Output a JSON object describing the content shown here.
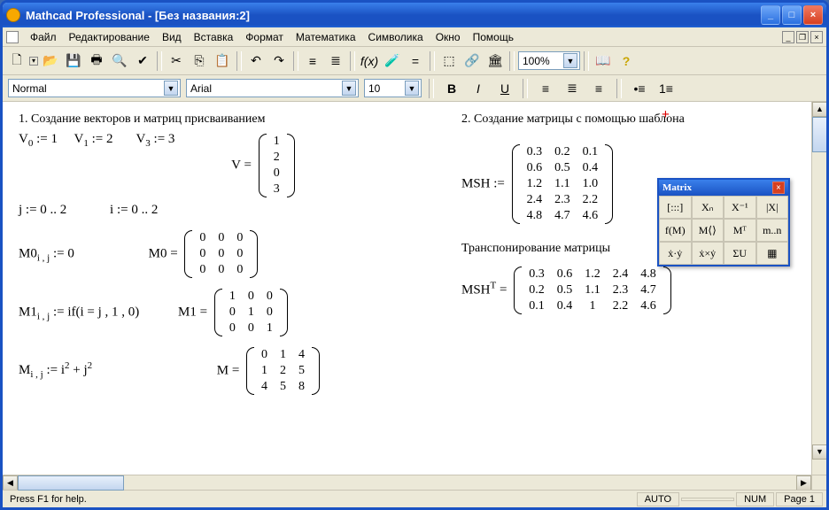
{
  "title": "Mathcad Professional - [Без названия:2]",
  "menus": [
    "Файл",
    "Редактирование",
    "Вид",
    "Вставка",
    "Формат",
    "Математика",
    "Символика",
    "Окно",
    "Помощь"
  ],
  "zoom": "100%",
  "style": "Normal",
  "font": "Arial",
  "fontsize": "10",
  "status_left": "Press F1 for help.",
  "status_auto": "AUTO",
  "status_num": "NUM",
  "status_page": "Page 1",
  "palette_title": "Matrix",
  "palette_cells": [
    "[:::]",
    "Xₙ",
    "X⁻¹",
    "|X|",
    "f(M)",
    "M⟨⟩",
    "Mᵀ",
    "m..n",
    "ẋ·ẏ",
    "ẋ×ẏ",
    "ΣU",
    "▦"
  ],
  "doc": {
    "h1": "1. Создание векторов и матриц присваиванием",
    "h2": "2. Создание матрицы с помощью шаблона",
    "h2b": "Транспонирование матрицы",
    "v0": "V",
    "v0sub": "0",
    "v0eq": " := 1",
    "v1": "V",
    "v1sub": "1",
    "v1eq": " := 2",
    "v3": "V",
    "v3sub": "3",
    "v3eq": " := 3",
    "j": "j := 0 .. 2",
    "i": "i := 0 .. 2",
    "m0": "M0",
    "m0sub": "i , j",
    "m0eq": " := 0",
    "m1": "M1",
    "m1sub": "i , j",
    "m1eq": " := if(i = j , 1 , 0)",
    "m": "M",
    "msub": "i , j",
    "meq": " := i",
    "msup1": "2",
    "mplus": " + j",
    "msup2": "2",
    "Vlabel": "V =",
    "M0label": "M0 =",
    "M1label": "M1 =",
    "Mlabel": "M =",
    "MSHlabel": "MSH :=",
    "MSHTlabel_pre": "MSH",
    "MSHTlabel_sup": "T",
    "MSHTlabel_post": " =",
    "V": [
      [
        "1"
      ],
      [
        "2"
      ],
      [
        "0"
      ],
      [
        "3"
      ]
    ],
    "M0": [
      [
        "0",
        "0",
        "0"
      ],
      [
        "0",
        "0",
        "0"
      ],
      [
        "0",
        "0",
        "0"
      ]
    ],
    "M1": [
      [
        "1",
        "0",
        "0"
      ],
      [
        "0",
        "1",
        "0"
      ],
      [
        "0",
        "0",
        "1"
      ]
    ],
    "M": [
      [
        "0",
        "1",
        "4"
      ],
      [
        "1",
        "2",
        "5"
      ],
      [
        "4",
        "5",
        "8"
      ]
    ],
    "MSH": [
      [
        "0.3",
        "0.2",
        "0.1"
      ],
      [
        "0.6",
        "0.5",
        "0.4"
      ],
      [
        "1.2",
        "1.1",
        "1.0"
      ],
      [
        "2.4",
        "2.3",
        "2.2"
      ],
      [
        "4.8",
        "4.7",
        "4.6"
      ]
    ],
    "MSHT": [
      [
        "0.3",
        "0.6",
        "1.2",
        "2.4",
        "4.8"
      ],
      [
        "0.2",
        "0.5",
        "1.1",
        "2.3",
        "4.7"
      ],
      [
        "0.1",
        "0.4",
        "1",
        "2.2",
        "4.6"
      ]
    ]
  }
}
